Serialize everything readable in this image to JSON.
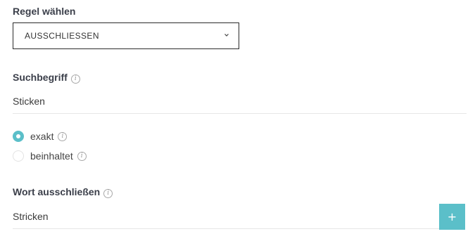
{
  "rule": {
    "label": "Regel wählen",
    "selected": "AUSSCHLIESSEN",
    "chevron_icon": "chevron-down-icon"
  },
  "search_term": {
    "label": "Suchbegriff",
    "value": "Sticken",
    "info_icon": "info-icon"
  },
  "match_options": [
    {
      "label": "exakt",
      "checked": true
    },
    {
      "label": "beinhaltet",
      "checked": false
    }
  ],
  "exclude_word": {
    "label": "Wort ausschließen",
    "value": "Stricken",
    "add_label": "+"
  },
  "colors": {
    "accent": "#5bbfc9",
    "border": "#2b2b2b",
    "divider": "#e6e6e6"
  }
}
